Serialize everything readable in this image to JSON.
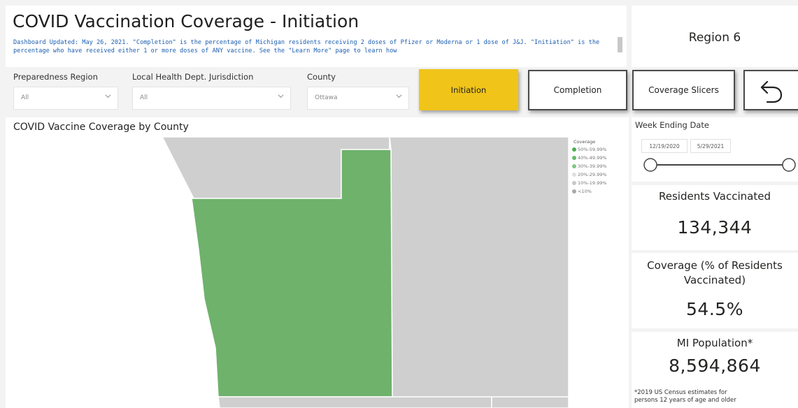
{
  "header": {
    "title": "COVID Vaccination Coverage - Initiation",
    "subtitle": "Dashboard Updated: May 26, 2021. \"Completion\" is the percentage of Michigan residents receiving 2 doses of Pfizer or Moderna or 1 dose of J&J. \"Initiation\" is the percentage who have received either 1 or more doses of ANY vaccine. See the \"Learn More\" page to learn how",
    "region": "Region 6"
  },
  "slicers": [
    {
      "label": "Preparedness Region",
      "value": "All"
    },
    {
      "label": "Local Health Dept. Jurisdiction",
      "value": "All"
    },
    {
      "label": "County",
      "value": "Ottawa"
    }
  ],
  "buttons": {
    "initiation": "Initiation",
    "completion": "Completion",
    "coverage_slicers": "Coverage Slicers",
    "back_icon": "back-arrow-icon"
  },
  "map": {
    "title": "COVID Vaccine Coverage by County",
    "legend_title": "Coverage",
    "legend": [
      {
        "label": "50%-59.99%",
        "color": "#4caf50"
      },
      {
        "label": "40%-49.99%",
        "color": "#66bb6a"
      },
      {
        "label": "30%-39.99%",
        "color": "#81c784"
      },
      {
        "label": "20%-29.99%",
        "color": "#e0e0e0"
      },
      {
        "label": "10%-19.99%",
        "color": "#c8c8c8"
      },
      {
        "label": "<10%",
        "color": "#a9a9a9"
      }
    ],
    "colors": {
      "highlight": "#6fb26c",
      "other": "#cfcfcf",
      "border": "#ffffff"
    }
  },
  "week": {
    "label": "Week Ending Date",
    "start": "12/19/2020",
    "end": "5/29/2021"
  },
  "cards": {
    "residents_label": "Residents Vaccinated",
    "residents_value": "134,344",
    "coverage_label": "Coverage (% of Residents Vaccinated)",
    "coverage_value": "54.5%",
    "population_label": "MI Population*",
    "population_value": "8,594,864",
    "footnote": "*2019 US Census estimates for persons 12 years of age and older"
  },
  "colors": {
    "accent": "#f0c419",
    "subtitle_text": "#1d5fb0"
  }
}
